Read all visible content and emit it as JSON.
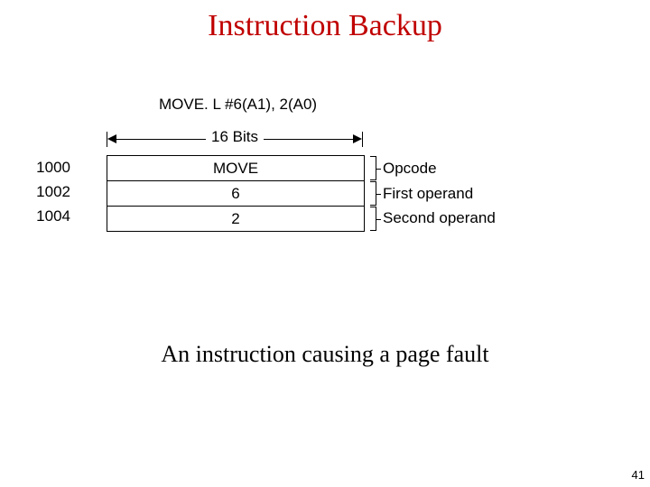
{
  "title": "Instruction Backup",
  "caption": "An instruction causing a page fault",
  "page_number": "41",
  "instruction_text": "MOVE. L #6(A1), 2(A0)",
  "width_label": "16 Bits",
  "addresses": [
    "1000",
    "1002",
    "1004"
  ],
  "cells": [
    "MOVE",
    "6",
    "2"
  ],
  "annotations": [
    "Opcode",
    "First operand",
    "Second operand"
  ],
  "chart_data": {
    "type": "table",
    "title": "Instruction Backup",
    "word_width_bits": 16,
    "instruction": "MOVE.L #6(A1), 2(A0)",
    "rows": [
      {
        "address": 1000,
        "content": "MOVE",
        "meaning": "Opcode"
      },
      {
        "address": 1002,
        "content": "6",
        "meaning": "First operand"
      },
      {
        "address": 1004,
        "content": "2",
        "meaning": "Second operand"
      }
    ]
  }
}
